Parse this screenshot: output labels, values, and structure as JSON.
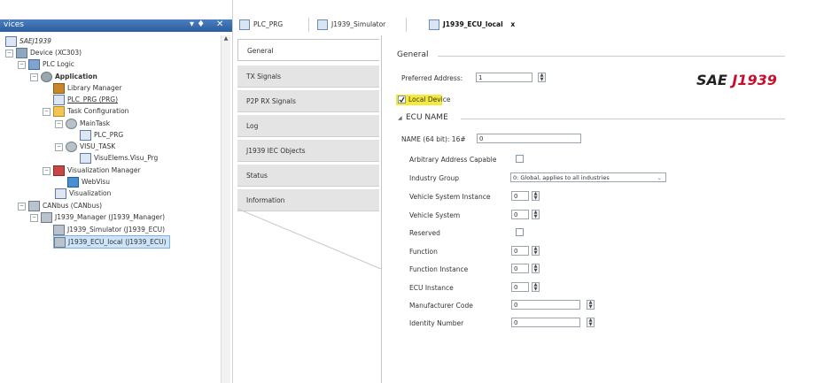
{
  "devices_panel": {
    "title": "vices",
    "pin": "▾ ♦",
    "close": "✕",
    "tree": [
      {
        "label": "SAEJ1939",
        "italic": true
      },
      {
        "label": "Device (XC303)"
      },
      {
        "label": "PLC Logic"
      },
      {
        "label": "Application",
        "bold": true
      },
      {
        "label": "Library Manager"
      },
      {
        "label": "PLC_PRG (PRG)"
      },
      {
        "label": "Task Configuration"
      },
      {
        "label": "MainTask"
      },
      {
        "label": "PLC_PRG"
      },
      {
        "label": "VISU_TASK"
      },
      {
        "label": "VisuElems.Visu_Prg"
      },
      {
        "label": "Visualization Manager"
      },
      {
        "label": "WebVisu"
      },
      {
        "label": "Visualization"
      },
      {
        "label": "CANbus (CANbus)"
      },
      {
        "label": "J1939_Manager (J1939_Manager)"
      },
      {
        "label": "J1939_Simulator (J1939_ECU)"
      },
      {
        "label": "J1939_ECU_local (J1939_ECU)"
      }
    ]
  },
  "tabs": [
    {
      "label": "PLC_PRG"
    },
    {
      "label": "J1939_Simulator"
    },
    {
      "label": "J1939_ECU_local",
      "close": "x"
    }
  ],
  "side_tabs": [
    "General",
    "TX Signals",
    "P2P RX Signals",
    "Log",
    "J1939 IEC Objects",
    "Status",
    "Information"
  ],
  "editor": {
    "general_title": "General",
    "preferred_address_label": "Preferred Address:",
    "preferred_address_value": "1",
    "local_device_label": "Local Device",
    "brand_prefix": "SAE",
    "brand_suffix": "J1939",
    "ecu_name_title": "ECU NAME",
    "name_label": "NAME (64 bit): 16#",
    "name_value": "0",
    "fields": [
      {
        "label": "Arbitrary Address Capable",
        "kind": "checkbox"
      },
      {
        "label": "Industry Group",
        "kind": "select",
        "value": "0: Global, applies to all industries"
      },
      {
        "label": "Vehicle System Instance",
        "kind": "spin",
        "value": "0"
      },
      {
        "label": "Vehicle System",
        "kind": "spin",
        "value": "0"
      },
      {
        "label": "Reserved",
        "kind": "checkbox"
      },
      {
        "label": "Function",
        "kind": "spin",
        "value": "0"
      },
      {
        "label": "Function Instance",
        "kind": "spin",
        "value": "0"
      },
      {
        "label": "ECU Instance",
        "kind": "spin",
        "value": "0"
      },
      {
        "label": "Manufacturer Code",
        "kind": "widespin",
        "value": "0"
      },
      {
        "label": "Identity Number",
        "kind": "widespin",
        "value": "0"
      }
    ]
  },
  "colors": {
    "brand_red": "#c8102e",
    "highlight": "#f5ea38",
    "header_blue": "#2d5d9c"
  }
}
